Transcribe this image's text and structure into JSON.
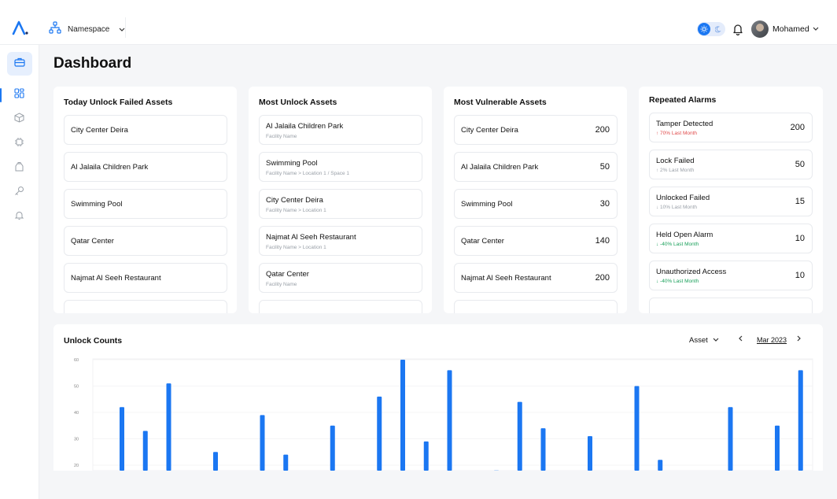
{
  "header": {
    "namespace_label": "Namespace",
    "user_name": "Mohamed"
  },
  "page": {
    "title": "Dashboard"
  },
  "cards": {
    "failed": {
      "title": "Today Unlock Failed Assets",
      "items": [
        "City Center Deira",
        "Al Jalaila Children Park",
        "Swimming Pool",
        "Qatar Center",
        "Najmat Al Seeh Restaurant"
      ]
    },
    "most_unlock": {
      "title": "Most Unlock Assets",
      "items": [
        {
          "name": "Al Jalaila Children Park",
          "path": "Facility Name"
        },
        {
          "name": "Swimming Pool",
          "path": "Facility Name > Location 1 / Space 1"
        },
        {
          "name": "City Center Deira",
          "path": "Facility Name > Location 1"
        },
        {
          "name": "Najmat Al Seeh Restaurant",
          "path": "Facility Name > Location 1"
        },
        {
          "name": "Qatar Center",
          "path": "Facility Name"
        }
      ]
    },
    "vulnerable": {
      "title": "Most Vulnerable Assets",
      "items": [
        {
          "name": "City Center Deira",
          "value": "200"
        },
        {
          "name": "Al Jalaila Children Park",
          "value": "50"
        },
        {
          "name": "Swimming Pool",
          "value": "30"
        },
        {
          "name": "Qatar Center",
          "value": "140"
        },
        {
          "name": "Najmat Al Seeh Restaurant",
          "value": "200"
        }
      ]
    },
    "alarms": {
      "title": "Repeated Alarms",
      "items": [
        {
          "name": "Tamper Detected",
          "value": "200",
          "trend": "↑ 70% Last Month"
        },
        {
          "name": "Lock Failed",
          "value": "50",
          "trend": "↑ 2% Last Month"
        },
        {
          "name": "Unlocked Failed",
          "value": "15",
          "trend": "↓ 10% Last Month"
        },
        {
          "name": "Held Open Alarm",
          "value": "10",
          "trend": "↓ -40% Last Month"
        },
        {
          "name": "Unauthorized Access",
          "value": "10",
          "trend": "↓ -40% Last Month"
        }
      ]
    }
  },
  "chart": {
    "title": "Unlock Counts",
    "filter_label": "Asset",
    "month_label": "Mar 2023",
    "prev_icon": "chevron-left-icon",
    "next_icon": "chevron-right-icon"
  },
  "colors": {
    "accent": "#1b77f2"
  },
  "chart_data": {
    "type": "bar",
    "title": "Unlock Counts",
    "xlabel": "",
    "ylabel": "",
    "yticks": [
      20,
      30,
      40,
      50,
      60
    ],
    "ylim": [
      17,
      60
    ],
    "grid": true,
    "values": [
      42,
      33,
      51,
      null,
      25,
      null,
      39,
      24,
      null,
      35,
      null,
      46,
      60,
      29,
      56,
      null,
      18,
      44,
      34,
      null,
      31,
      null,
      50,
      22,
      null,
      null,
      42,
      null,
      35,
      56
    ]
  }
}
